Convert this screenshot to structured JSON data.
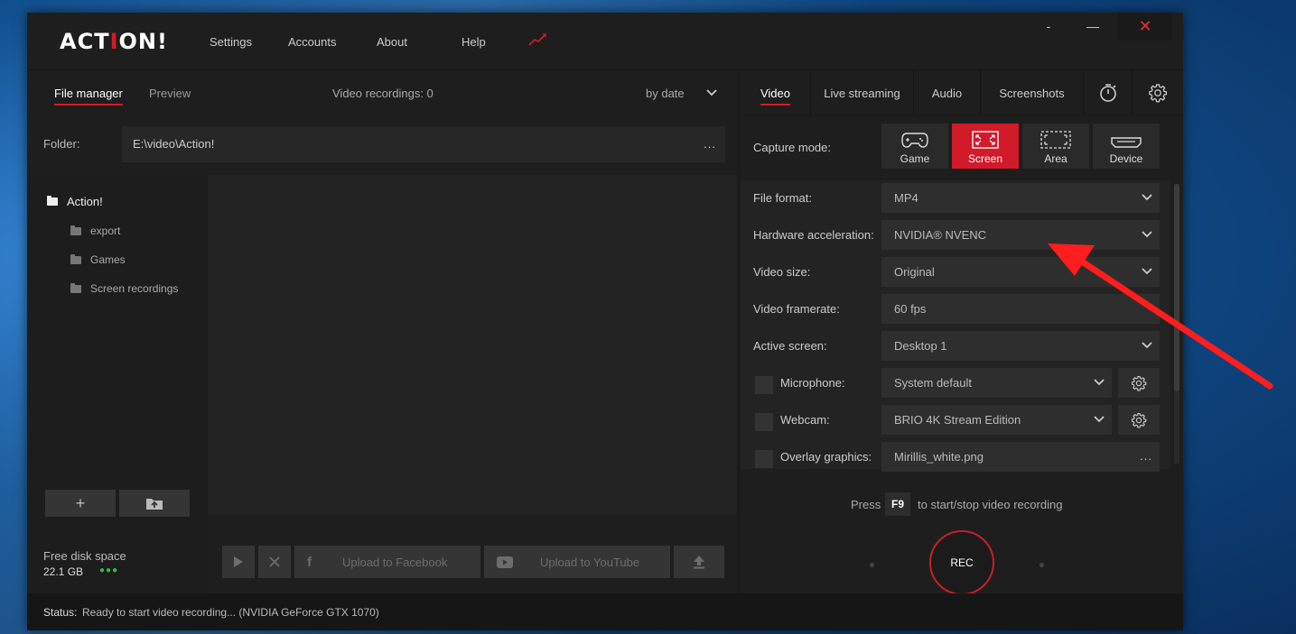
{
  "app": {
    "logo": {
      "main": "ACT",
      "accent": "I",
      "rest": "ON!"
    },
    "menu": [
      "Settings",
      "Accounts",
      "About",
      "Help"
    ],
    "window_controls": {
      "minimize": "-",
      "maximize": "—",
      "close": "✕"
    },
    "accent_color": "#d11a2a"
  },
  "left": {
    "tabs": [
      {
        "label": "File manager",
        "active": true
      },
      {
        "label": "Preview",
        "active": false
      }
    ],
    "recordings_count": "Video recordings: 0",
    "sort": "by date",
    "folder": {
      "label": "Folder:",
      "path": "E:\\video\\Action!",
      "more": "..."
    },
    "tree": [
      {
        "label": "Action!",
        "root": true
      },
      {
        "label": "export"
      },
      {
        "label": "Games"
      },
      {
        "label": "Screen recordings"
      }
    ],
    "tree_buttons": {
      "add": "+",
      "upload_icon": "folder-upload-icon"
    },
    "disk": {
      "label": "Free disk space",
      "value": "22.1 GB"
    },
    "tools": {
      "facebook": "Upload to Facebook",
      "youtube": "Upload to YouTube"
    }
  },
  "status": {
    "label": "Status:",
    "text": "Ready to start video recording...  (NVIDIA GeForce GTX 1070)"
  },
  "right": {
    "tabs": [
      {
        "label": "Video",
        "active": true
      },
      {
        "label": "Live streaming"
      },
      {
        "label": "Audio"
      },
      {
        "label": "Screenshots"
      }
    ],
    "capture": {
      "label": "Capture mode:",
      "modes": [
        {
          "label": "Game",
          "icon": "gamepad-icon"
        },
        {
          "label": "Screen",
          "icon": "fullscreen-icon",
          "active": true
        },
        {
          "label": "Area",
          "icon": "area-select-icon"
        },
        {
          "label": "Device",
          "icon": "hdmi-device-icon"
        }
      ]
    },
    "settings": {
      "file_format": {
        "label": "File format:",
        "value": "MP4"
      },
      "hw_accel": {
        "label": "Hardware acceleration:",
        "value": "NVIDIA® NVENC"
      },
      "video_size": {
        "label": "Video size:",
        "value": "Original"
      },
      "framerate": {
        "label": "Video framerate:",
        "value": "60 fps"
      },
      "active_screen": {
        "label": "Active screen:",
        "value": "Desktop 1"
      },
      "microphone": {
        "label": "Microphone:",
        "value": "System default"
      },
      "webcam": {
        "label": "Webcam:",
        "value": "BRIO 4K Stream Edition"
      },
      "overlay": {
        "label": "Overlay graphics:",
        "value": "Mirillis_white.png",
        "more": "..."
      }
    },
    "rec": {
      "press": "Press",
      "key": "F9",
      "hint": "to start/stop video recording",
      "button": "REC"
    }
  }
}
